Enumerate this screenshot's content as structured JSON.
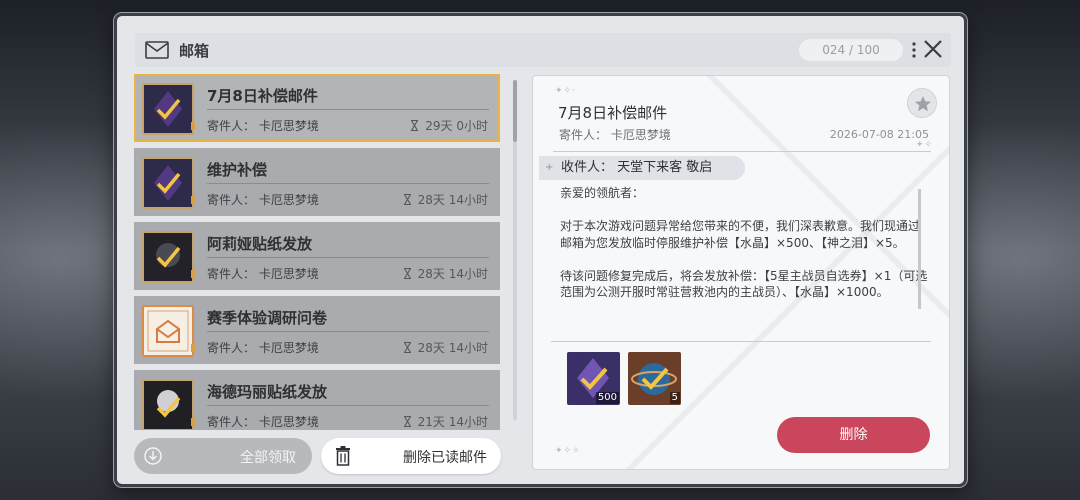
{
  "window": {
    "title": "邮箱",
    "counter": "024 / 100"
  },
  "mails": [
    {
      "title": "7月8日补偿邮件",
      "sender": "寄件人：  卡厄思梦境",
      "time": "29天 0小时",
      "selected": true,
      "thumb": "crystal"
    },
    {
      "title": "维护补偿",
      "sender": "寄件人：  卡厄思梦境",
      "time": "28天 14小时",
      "selected": false,
      "thumb": "crystal"
    },
    {
      "title": "阿莉娅贴纸发放",
      "sender": "寄件人：  卡厄思梦境",
      "time": "28天 14小时",
      "selected": false,
      "thumb": "sticker"
    },
    {
      "title": "赛季体验调研问卷",
      "sender": "寄件人：  卡厄思梦境",
      "time": "28天 14小时",
      "selected": false,
      "thumb": "envelope"
    },
    {
      "title": "海德玛丽贴纸发放",
      "sender": "寄件人：  卡厄思梦境",
      "time": "21天 14小时",
      "selected": false,
      "thumb": "sticker2"
    }
  ],
  "buttons": {
    "claim_all": "全部领取",
    "delete_read": "删除已读邮件",
    "delete": "删除"
  },
  "detail": {
    "title": "7月8日补偿邮件",
    "sender": "寄件人：  卡厄思梦境",
    "date": "2026-07-08 21:05",
    "recipient": "收件人：  天堂下来客 敬启",
    "greeting": "亲爱的领航者：",
    "para1": "对于本次游戏问题异常给您带来的不便，我们深表歉意。我们现通过邮箱为您发放临时停服维护补偿【水晶】×500、【神之泪】×5。",
    "para2": "待该问题修复完成后，将会发放补偿：【5星主战员自选券】×1（可选范围为公测开服时常驻营救池内的主战员）、【水晶】×1000。",
    "attachments": [
      {
        "icon": "crystal-icon",
        "qty": "500"
      },
      {
        "icon": "tear-icon",
        "qty": "5"
      }
    ]
  },
  "colors": {
    "selected_border": "#e8b542",
    "delete_button": "#c9465d"
  }
}
